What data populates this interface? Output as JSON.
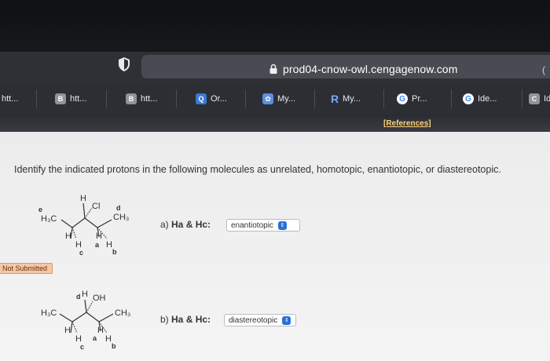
{
  "browser": {
    "url": "prod04-cnow-owl.cengagenow.com",
    "url_right": "(",
    "tabs": [
      {
        "label": "htt...",
        "icon": "none"
      },
      {
        "label": "htt...",
        "icon": "b-icon"
      },
      {
        "label": "htt...",
        "icon": "b-icon"
      },
      {
        "label": "Or...",
        "icon": "q-icon"
      },
      {
        "label": "My...",
        "icon": "my-icon"
      },
      {
        "label": "My...",
        "icon": "r-icon"
      },
      {
        "label": "Pr...",
        "icon": "google-icon"
      },
      {
        "label": "Ide...",
        "icon": "google-icon"
      },
      {
        "label": "Id",
        "icon": "c-icon"
      }
    ]
  },
  "references": "[References]",
  "question": "Identify the indicated protons in the following molecules as unrelated, homotopic, enantiotopic, or diastereotopic.",
  "molecule1": {
    "labels": {
      "e": "e",
      "h3c": "H₃C",
      "h_top": "H",
      "cl": "Cl",
      "d": "d",
      "ch3": "CH₃",
      "h_left": "H",
      "h_mid": "H",
      "h_a": "H",
      "a": "a",
      "h_b": "H",
      "b": "b",
      "c": "c"
    }
  },
  "molecule2": {
    "labels": {
      "d": "d",
      "h_top": "H",
      "oh": "OH",
      "h3c": "H₃C",
      "ch3": "CH₃",
      "h_left": "H",
      "h_mid": "H",
      "h_a": "H",
      "a": "a",
      "h_b": "H",
      "b": "b",
      "c": "c"
    }
  },
  "questions": [
    {
      "label_prefix": "a) ",
      "label_bold": "Ha & Hc:",
      "selected": "enantiotopic"
    },
    {
      "label_prefix": "b) ",
      "label_bold": "Ha & Hc:",
      "selected": "diastereotopic"
    }
  ],
  "status_badge": "Not Submitted",
  "colors": {
    "accent": "#2b6fd6",
    "badge_bg": "#f6c7a5",
    "references": "#ffd47a"
  }
}
